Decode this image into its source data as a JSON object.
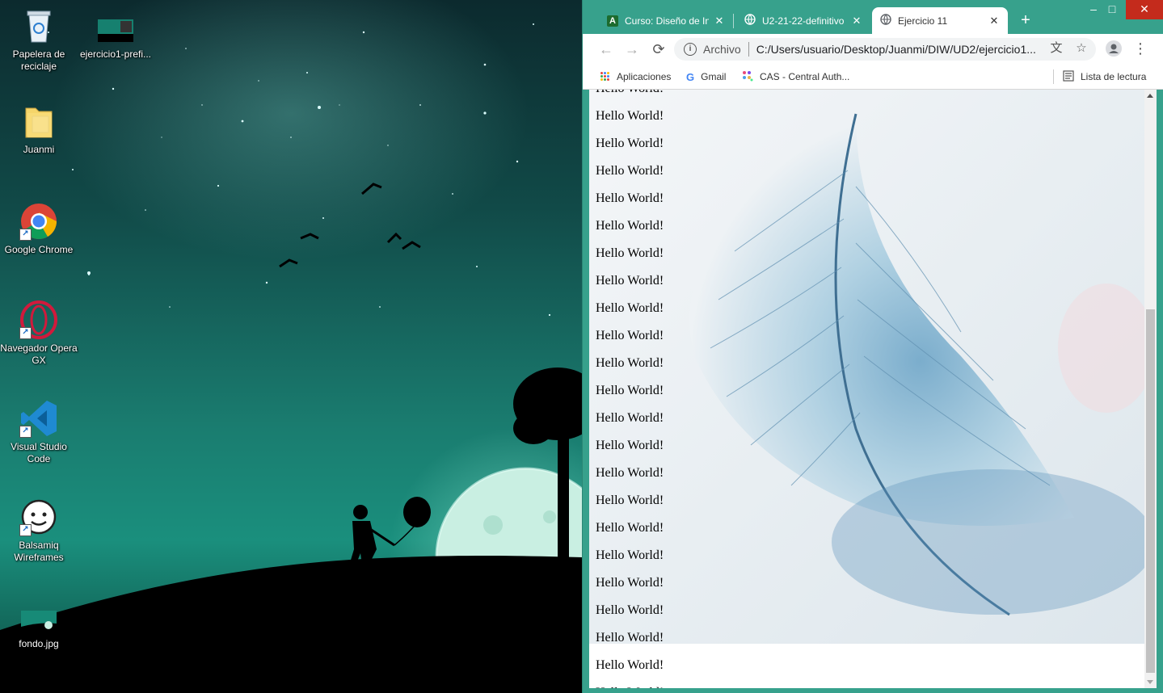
{
  "desktop": {
    "icons": [
      {
        "label": "Papelera de reciclaje",
        "icon": "recycle-bin-icon"
      },
      {
        "label": "ejercicio1-prefi...",
        "icon": "image-file-icon"
      },
      {
        "label": "Juanmi",
        "icon": "folder-icon"
      },
      {
        "label": "Google Chrome",
        "icon": "chrome-icon"
      },
      {
        "label": "Navegador Opera GX",
        "icon": "opera-gx-icon"
      },
      {
        "label": "Visual Studio Code",
        "icon": "vscode-icon"
      },
      {
        "label": "Balsamiq Wireframes",
        "icon": "balsamiq-icon"
      },
      {
        "label": "fondo.jpg",
        "icon": "image-file-icon"
      }
    ]
  },
  "browser": {
    "tabs": [
      {
        "title": "Curso: Diseño de Interfaces",
        "favicon": "moodle-a-icon",
        "active": false
      },
      {
        "title": "U2-21-22-definitivo",
        "favicon": "globe-icon",
        "active": false
      },
      {
        "title": "Ejercicio 11",
        "favicon": "globe-icon",
        "active": true
      }
    ],
    "new_tab": "+",
    "window_controls": {
      "minimize": "–",
      "maximize": "□",
      "close": "✕"
    },
    "toolbar": {
      "back": "←",
      "forward": "→",
      "reload": "⟳",
      "scheme_label": "Archivo",
      "url": "C:/Users/usuario/Desktop/Juanmi/DIW/UD2/ejercicio1...",
      "translate": "文",
      "bookmark_star": "☆",
      "menu": "⋮"
    },
    "bookmarks": [
      {
        "label": "Aplicaciones",
        "icon": "apps-grid-icon"
      },
      {
        "label": "Gmail",
        "icon": "google-g-icon"
      },
      {
        "label": "CAS - Central Auth...",
        "icon": "cas-dots-icon"
      }
    ],
    "reading_list": "Lista de lectura"
  },
  "page": {
    "lines": [
      "Hello World!",
      "Hello World!",
      "Hello World!",
      "Hello World!",
      "Hello World!",
      "Hello World!",
      "Hello World!",
      "Hello World!",
      "Hello World!",
      "Hello World!",
      "Hello World!",
      "Hello World!",
      "Hello World!",
      "Hello World!",
      "Hello World!",
      "Hello World!",
      "Hello World!",
      "Hello World!",
      "Hello World!",
      "Hello World!",
      "Hello World!",
      "Hello World!",
      "Hello World!"
    ]
  },
  "colors": {
    "browser_frame": "#37a18c",
    "tab_active_bg": "#ffffff",
    "close_button": "#c42b1c"
  }
}
